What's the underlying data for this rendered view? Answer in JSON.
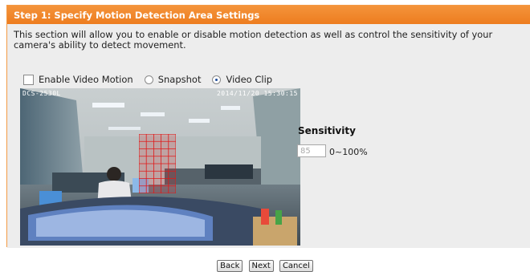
{
  "header": {
    "title": "Step 1: Specify Motion Detection Area Settings"
  },
  "description": "This section will allow you to enable or disable motion detection as well as control the sensitivity of your camera's ability to detect movement.",
  "options": {
    "enable_label": "Enable Video Motion",
    "enable_checked": false,
    "snapshot_label": "Snapshot",
    "videoclip_label": "Video Clip",
    "selected": "Video Clip"
  },
  "video": {
    "timestamp_left": "DCS-2530L",
    "timestamp_right": "2014/11/20 15:30:15"
  },
  "sensitivity": {
    "title": "Sensitivity",
    "value": "85",
    "range": "0~100%"
  },
  "buttons": {
    "back": "Back",
    "next": "Next",
    "cancel": "Cancel"
  },
  "colors": {
    "header": "#ed7d1f",
    "grid": "#e01818",
    "content_bg": "#ededed"
  }
}
